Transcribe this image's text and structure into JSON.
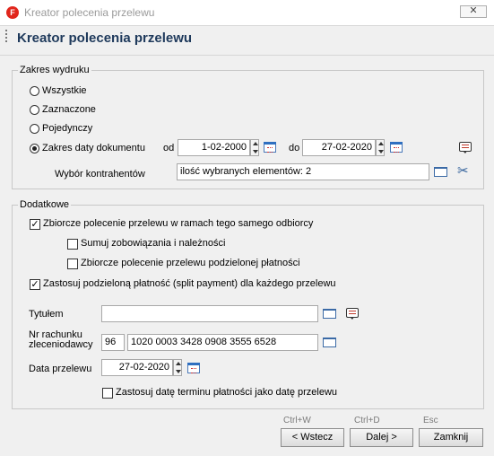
{
  "window": {
    "title": "Kreator polecenia przelewu",
    "app_icon_letter": "F",
    "close_glyph": "✕"
  },
  "header": {
    "title": "Kreator polecenia przelewu"
  },
  "zakres": {
    "group_label": "Zakres wydruku",
    "options": [
      "Wszystkie",
      "Zaznaczone",
      "Pojedynczy",
      "Zakres daty dokumentu"
    ],
    "selected": "Zakres daty dokumentu",
    "od_label": "od",
    "od_value": "1-02-2000",
    "do_label": "do",
    "do_value": "27-02-2020",
    "kontrahenci_label": "Wybór kontrahentów",
    "kontrahenci_value": "ilość wybranych elementów: 2"
  },
  "dodatkowe": {
    "group_label": "Dodatkowe",
    "cb_zbiorcze": {
      "label": "Zbiorcze polecenie przelewu w ramach tego samego odbiorcy",
      "checked": true
    },
    "cb_sumuj": {
      "label": "Sumuj zobowiązania i należności",
      "checked": false
    },
    "cb_zbiorcze_podzielonej": {
      "label": "Zbiorcze polecenie przelewu podzielonej płatności",
      "checked": false
    },
    "cb_split": {
      "label": "Zastosuj podzieloną płatność (split payment) dla każdego przelewu",
      "checked": true
    },
    "tytulem_label": "Tytułem",
    "tytulem_value": "",
    "nr_rachunku_label_1": "Nr rachunku",
    "nr_rachunku_label_2": "zleceniodawcy",
    "rachunek_prefix": "96",
    "rachunek_value": "1020 0003 3428 0908 3555 6528",
    "data_przelewu_label": "Data przelewu",
    "data_przelewu_value": "27-02-2020",
    "cb_termin": {
      "label": "Zastosuj datę terminu płatności jako datę przelewu",
      "checked": false
    }
  },
  "footer": {
    "back_shortcut": "Ctrl+W",
    "back_label": "< Wstecz",
    "next_shortcut": "Ctrl+D",
    "next_label": "Dalej >",
    "close_shortcut": "Esc",
    "close_label": "Zamknij"
  },
  "colors": {
    "title_text": "#1e395b",
    "app_icon": "#e1261c",
    "background": "#f0f0f0"
  }
}
